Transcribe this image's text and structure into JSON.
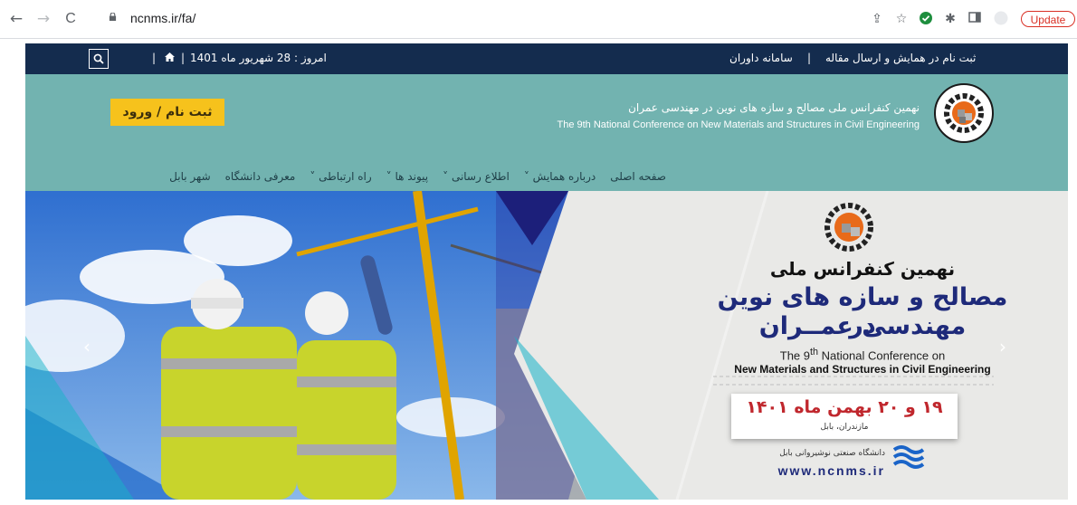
{
  "browser": {
    "url": "ncnms.ir/fa/",
    "update_label": "Update",
    "back_icon": "←",
    "forward_icon": "→",
    "reload_icon": "C"
  },
  "topbar": {
    "date_text": "امروز : 28 شهریور ماه 1401",
    "sep1": "|",
    "sep2": "|",
    "register_link": "ثبت نام در همایش و ارسال مقاله",
    "judges_link": "سامانه داوران",
    "sep3": "|"
  },
  "header": {
    "register_login": "ثبت نام / ورود",
    "conf_title_fa": "نهمین کنفرانس ملی مصالح و سازه های نوین در مهندسی عمران",
    "conf_title_en": "The 9th National Conference on New Materials and Structures in Civil Engineering"
  },
  "menu": [
    {
      "label": "صفحه اصلی",
      "chevron": ""
    },
    {
      "label": "درباره همایش",
      "chevron": "˅"
    },
    {
      "label": "اطلاع رسانی",
      "chevron": "˅"
    },
    {
      "label": "پیوند ها",
      "chevron": "˅"
    },
    {
      "label": "راه ارتباطی",
      "chevron": "˅"
    },
    {
      "label": "معرفی دانشگاه",
      "chevron": ""
    },
    {
      "label": "شهر بابل",
      "chevron": ""
    }
  ],
  "banner": {
    "line1": "نهمین کنفرانس ملی",
    "line2": "مصالح و سازه های نوین در",
    "line3": "مهندسی عمــران",
    "en_line1_pre": "The 9",
    "en_line1_sup": "th",
    "en_line1_post": " National Conference on",
    "en_line2": "New Materials and Structures in Civil Engineering",
    "date": "۱۹ و ۲۰ بهمن ماه ۱۴۰۱",
    "location": "مازندران، بابل",
    "university": "دانشگاه صنعتی نوشیروانی بابل",
    "website": "www.ncnms.ir"
  },
  "colors": {
    "topbar": "#142c4e",
    "header": "#72b3b0",
    "button": "#f6c21c",
    "banner_navy": "#1c1f7a",
    "banner_title": "#1e2a7a",
    "date_red": "#c0272d"
  }
}
